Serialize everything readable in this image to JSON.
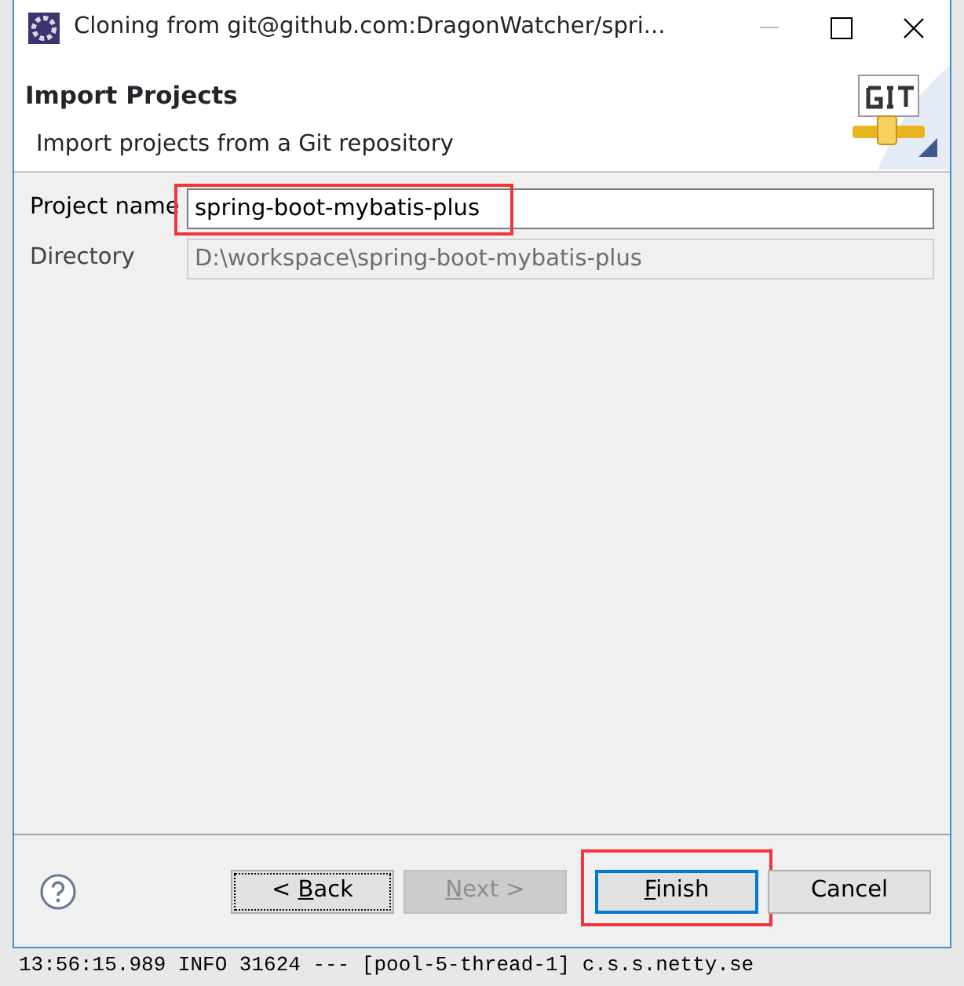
{
  "window": {
    "title": "Cloning from git@github.com:DragonWatcher/spri..."
  },
  "header": {
    "title": "Import Projects",
    "description": "Import projects from a Git repository"
  },
  "fields": [
    {
      "label": "Project name",
      "value": "spring-boot-mybatis-plus",
      "disabled": false,
      "highlighted": true
    },
    {
      "label": "Directory",
      "value": "D:\\workspace\\spring-boot-mybatis-plus",
      "disabled": true
    }
  ],
  "buttons": [
    {
      "before": "< ",
      "key": "B",
      "after": "ack",
      "disabled": false,
      "focused": true,
      "default": false
    },
    {
      "key": "N",
      "after": "ext >",
      "disabled": true,
      "focused": false,
      "default": false
    },
    {
      "key": "F",
      "after": "inish",
      "disabled": false,
      "focused": false,
      "default": true,
      "highlighted": true
    },
    {
      "after": "Cancel",
      "disabled": false,
      "focused": false,
      "default": false
    }
  ],
  "background_log": "13:56:15.989  INFO 31624 --- [pool-5-thread-1] c.s.s.netty.se"
}
